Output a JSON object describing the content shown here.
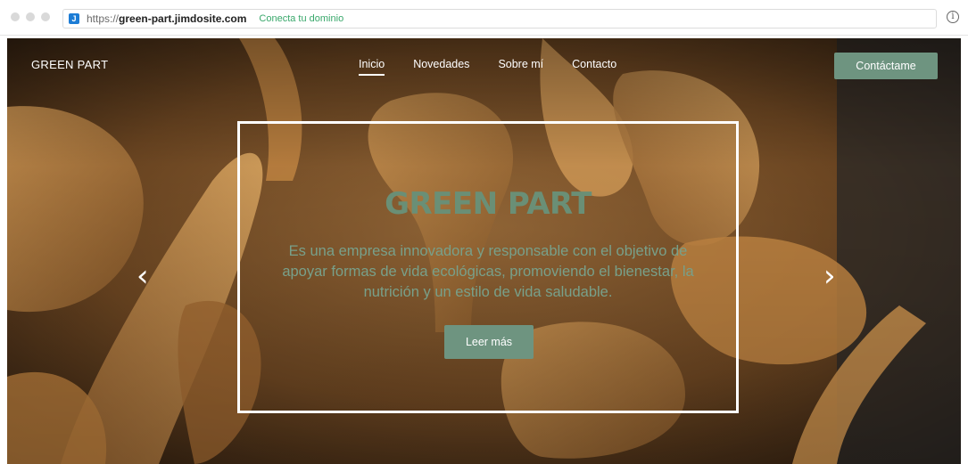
{
  "browser": {
    "url_scheme": "https://",
    "url_host": "green-part.jimdosite.com",
    "domain_link": "Conecta tu dominio",
    "favicon_letter": "J",
    "info_icon": "info-icon"
  },
  "site": {
    "brand": "GREEN PART",
    "nav": [
      {
        "label": "Inicio",
        "active": true
      },
      {
        "label": "Novedades",
        "active": false
      },
      {
        "label": "Sobre mí",
        "active": false
      },
      {
        "label": "Contacto",
        "active": false
      }
    ],
    "cta_label": "Contáctame"
  },
  "hero": {
    "headline": "GREEN PART",
    "tagline": "Es una empresa innovadora y responsable con el objetivo de apoyar formas de vida ecológicas, promoviendo el bienestar, la nutrición y un estilo de vida saludable.",
    "button_label": "Leer más",
    "prev_arrow": "‹",
    "next_arrow": "›"
  },
  "colors": {
    "accent_green": "#6e9480",
    "headline_green": "#6a8f76",
    "domain_link_green": "#39a86b"
  }
}
